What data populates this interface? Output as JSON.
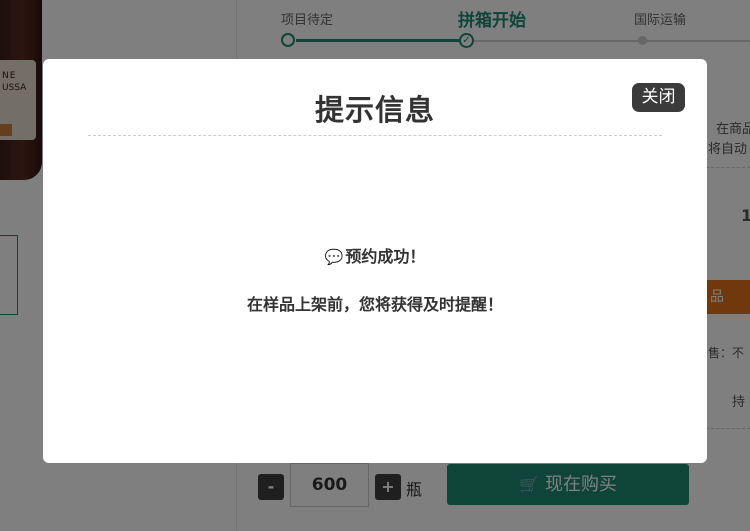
{
  "product": {
    "label_line1": "NE",
    "label_line2": "USSA"
  },
  "steps": [
    {
      "label": "项目待定",
      "state": "done"
    },
    {
      "label": "拼箱开始",
      "state": "active"
    },
    {
      "label": "国际运输",
      "state": "todo"
    }
  ],
  "right_panel": {
    "text1": "在商品",
    "text2": "将自动",
    "number": "1",
    "button_label": "品",
    "sale_text": "售：不",
    "text3": "持"
  },
  "purchase": {
    "decrease_label": "-",
    "quantity": "600",
    "increase_label": "+",
    "unit": "瓶",
    "buy_label": "现在购买",
    "cart_icon": "cart-icon"
  },
  "modal": {
    "title": "提示信息",
    "close_label": "关闭",
    "message_icon": "💬",
    "message1": "预约成功！",
    "message2": "在样品上架前，您将获得及时提醒！"
  },
  "colors": {
    "accent": "#1f8a70",
    "orange": "#e0701a",
    "overlay": "rgba(0,0,0,0.5)"
  }
}
